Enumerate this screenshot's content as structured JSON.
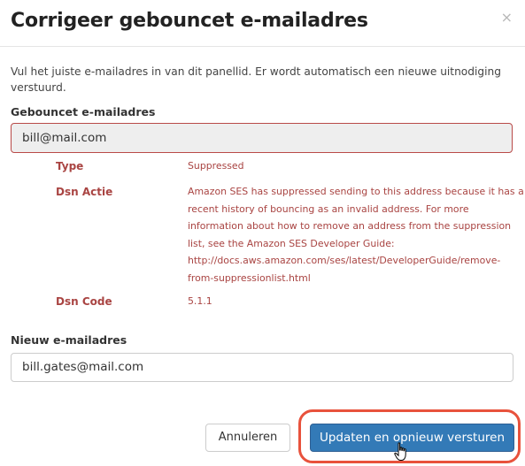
{
  "modal": {
    "title": "Corrigeer gebouncet e-mailadres",
    "close_icon": "×",
    "intro": "Vul het juiste e-mailadres in van dit panellid. Er wordt automatisch een nieuwe uitnodiging verstuurd."
  },
  "bounced": {
    "label": "Gebouncet e-mailadres",
    "value": "bill@mail.com"
  },
  "details": {
    "type_label": "Type",
    "type_value": "Suppressed",
    "action_label": "Dsn Actie",
    "action_value": "Amazon SES has suppressed sending to this address because it has a recent history of bouncing as an invalid address. For more information about how to remove an address from the suppression list, see the Amazon SES Developer Guide: http://docs.aws.amazon.com/ses/latest/DeveloperGuide/remove-from-suppressionlist.html",
    "code_label": "Dsn Code",
    "code_value": "5.1.1"
  },
  "new_email": {
    "label": "Nieuw e-mailadres",
    "value": "bill.gates@mail.com"
  },
  "footer": {
    "cancel_label": "Annuleren",
    "submit_label": "Updaten en opnieuw versturen"
  },
  "colors": {
    "primary": "#337ab7",
    "error": "#a94442",
    "highlight": "#e8523c"
  }
}
